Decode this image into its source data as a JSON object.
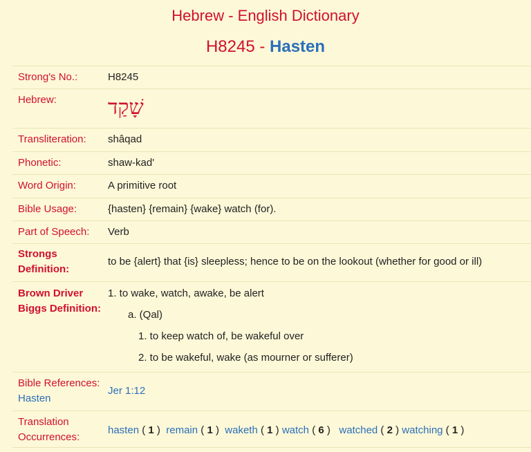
{
  "header": {
    "app_title": "Hebrew - English Dictionary",
    "entry_number": "H8245",
    "separator": " - ",
    "entry_word": "Hasten"
  },
  "fields": {
    "strongs_no": {
      "label": "Strong's No.:",
      "value": "H8245"
    },
    "hebrew": {
      "label": "Hebrew:",
      "value": "שָׁקַד"
    },
    "transliteration": {
      "label": "Transliteration:",
      "value": "shâqad"
    },
    "phonetic": {
      "label": "Phonetic:",
      "value": "shaw-kad'"
    },
    "word_origin": {
      "label": "Word Origin:",
      "value": "A primitive root"
    },
    "bible_usage": {
      "label": "Bible Usage:",
      "value": "{hasten} {remain} {wake} watch (for)."
    },
    "part_of_speech": {
      "label": "Part of Speech:",
      "value": "Verb"
    },
    "strongs_definition": {
      "label_line1": "Strongs",
      "label_line2": "Definition:",
      "value": "to be {alert} that {is} sleepless; hence to be on the lookout (whether for good or ill)"
    },
    "bdb_definition": {
      "label_line1": "Brown Driver",
      "label_line2": "Biggs Definition:",
      "lines": [
        "1. to wake, watch, awake, be alert",
        "a. (Qal)",
        "1. to keep watch of, be wakeful over",
        "2. to be wakeful, wake (as mourner or sufferer)"
      ]
    },
    "bible_references": {
      "label": "Bible References:",
      "sublabel": "Hasten",
      "value": "Jer 1:12"
    },
    "translation_occurrences": {
      "label_line1": "Translation",
      "label_line2": "Occurrences:",
      "items": [
        {
          "word": "hasten",
          "count": "1"
        },
        {
          "word": "remain",
          "count": "1"
        },
        {
          "word": "waketh",
          "count": "1"
        },
        {
          "word": "watch",
          "count": "6"
        },
        {
          "word": "watched",
          "count": "2"
        },
        {
          "word": "watching",
          "count": "1"
        }
      ]
    }
  },
  "colors": {
    "background": "#fdf8d8",
    "label_red": "#d0112b",
    "link_blue": "#2a6fba",
    "divider": "#ece4b6"
  }
}
